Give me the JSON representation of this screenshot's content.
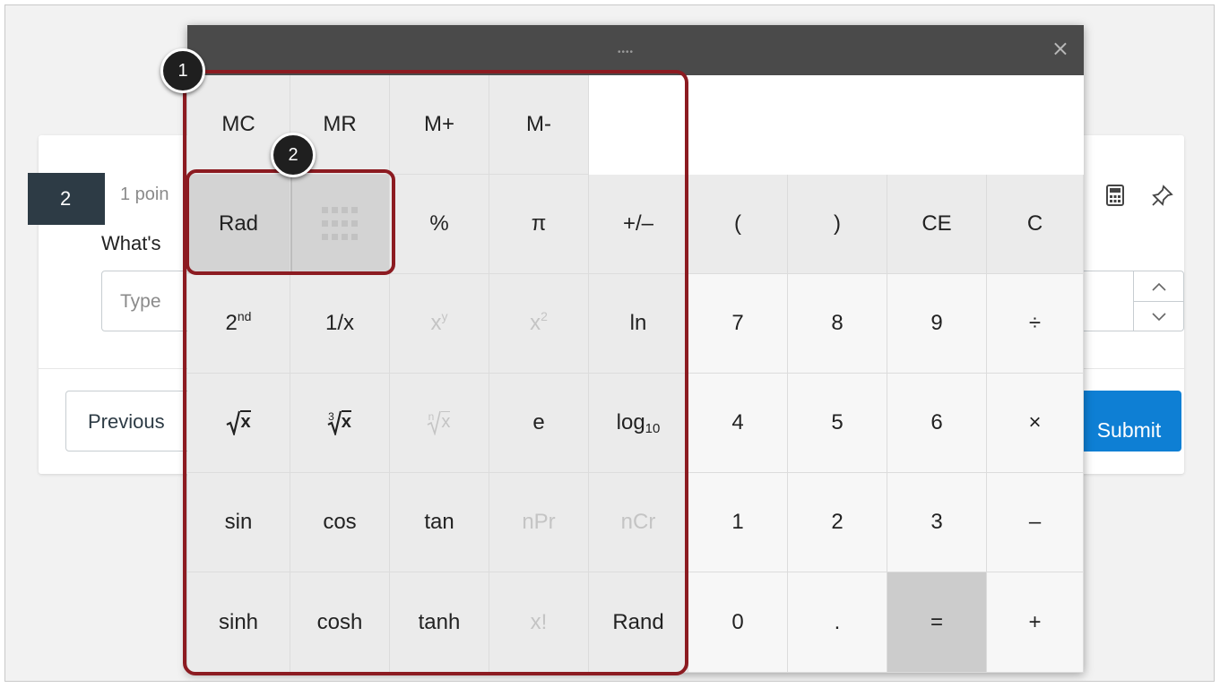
{
  "quiz": {
    "question_number": "2",
    "points": "1 poin",
    "question_text": "What's",
    "answer_placeholder": "Type",
    "previous_label": "Previous",
    "submit_label": "Submit"
  },
  "icons": {
    "calculator": "calculator-icon",
    "pin": "pin-icon",
    "close": "close-icon",
    "drag_handle": "drag-grip-icon",
    "keypad": "keypad-grid-icon"
  },
  "calculator": {
    "grip": "••••",
    "close": "×",
    "display_value": "",
    "memory": [
      "MC",
      "MR",
      "M+",
      "M-"
    ],
    "keys": {
      "rad": "Rad",
      "percent": "%",
      "pi": "π",
      "plus_minus": "+/–",
      "open_paren": "(",
      "close_paren": ")",
      "ce": "CE",
      "c": "C",
      "second": "2",
      "second_sup": "nd",
      "reciprocal": "1/x",
      "x_pow_y_base": "x",
      "x_pow_y_sup": "y",
      "x_sq_base": "x",
      "x_sq_sup": "2",
      "ln": "ln",
      "n7": "7",
      "n8": "8",
      "n9": "9",
      "divide": "÷",
      "sqrt_x": "x",
      "cbrt_index": "3",
      "cbrt_x": "x",
      "nroot_index": "n",
      "nroot_x": "x",
      "e": "e",
      "log_base": "log",
      "log_sub": "10",
      "n4": "4",
      "n5": "5",
      "n6": "6",
      "multiply": "×",
      "sin": "sin",
      "cos": "cos",
      "tan": "tan",
      "npr": "nPr",
      "ncr": "nCr",
      "n1": "1",
      "n2": "2",
      "n3": "3",
      "minus": "–",
      "sinh": "sinh",
      "cosh": "cosh",
      "tanh": "tanh",
      "factorial": "x!",
      "rand": "Rand",
      "n0": "0",
      "dot": ".",
      "equals": "=",
      "plus": "+"
    }
  },
  "annotations": {
    "badge1": "1",
    "badge2": "2",
    "highlight_color": "#8c1b21"
  },
  "colors": {
    "submit": "#0e7fd4",
    "question_badge": "#2d3b45",
    "titlebar": "#4a4a4a"
  }
}
